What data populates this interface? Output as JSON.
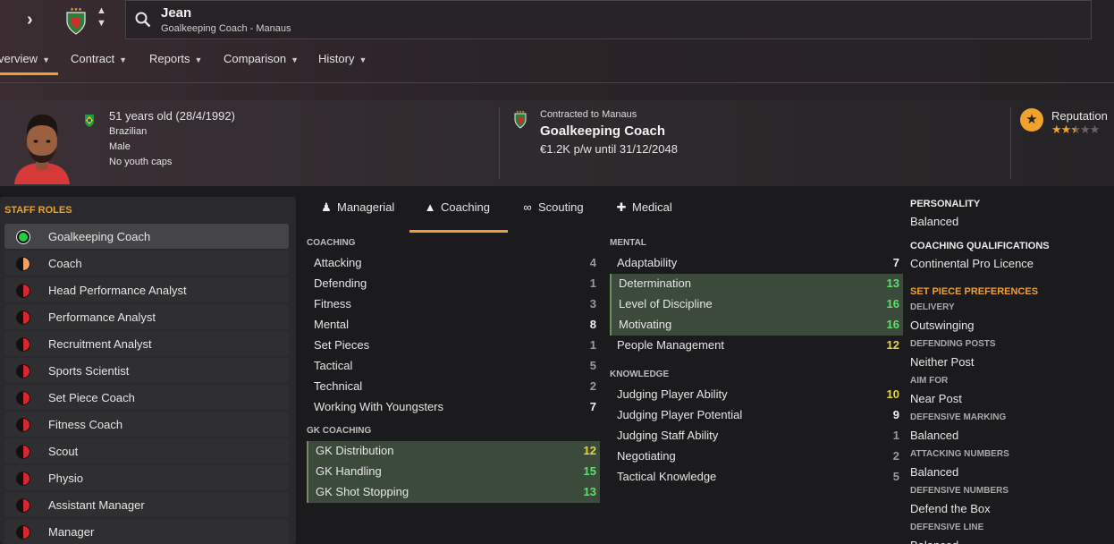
{
  "header": {
    "name": "Jean",
    "subtitle": "Goalkeeping Coach - Manaus",
    "icons": {
      "nav": "chevron-right-icon",
      "crest": "club-crest-icon",
      "search": "search-icon"
    }
  },
  "tabs": [
    {
      "label": "Overview",
      "active": true
    },
    {
      "label": "Contract"
    },
    {
      "label": "Reports"
    },
    {
      "label": "Comparison"
    },
    {
      "label": "History"
    }
  ],
  "visible_tab_prefix": "verview",
  "profile": {
    "age": "51 years old (28/4/1992)",
    "nationality": "Brazilian",
    "gender": "Male",
    "youth_caps": "No youth caps"
  },
  "contract": {
    "label": "Contracted to Manaus",
    "role": "Goalkeeping Coach",
    "wage": "€1.2K p/w until 31/12/2048"
  },
  "reputation": {
    "label": "Reputation",
    "stars": 2.5,
    "max": 5
  },
  "staff_roles": {
    "title": "STAFF ROLES",
    "items": [
      {
        "label": "Goalkeeping Coach",
        "color": "#22cc44",
        "fill": "full",
        "selected": true
      },
      {
        "label": "Coach",
        "color": "#f0a064",
        "fill": "half"
      },
      {
        "label": "Head Performance Analyst",
        "color": "#d4262c",
        "fill": "half"
      },
      {
        "label": "Performance Analyst",
        "color": "#d4262c",
        "fill": "half"
      },
      {
        "label": "Recruitment Analyst",
        "color": "#d4262c",
        "fill": "half"
      },
      {
        "label": "Sports Scientist",
        "color": "#d4262c",
        "fill": "half"
      },
      {
        "label": "Set Piece Coach",
        "color": "#d4262c",
        "fill": "half"
      },
      {
        "label": "Fitness Coach",
        "color": "#d4262c",
        "fill": "half"
      },
      {
        "label": "Scout",
        "color": "#d4262c",
        "fill": "half"
      },
      {
        "label": "Physio",
        "color": "#d4262c",
        "fill": "half"
      },
      {
        "label": "Assistant Manager",
        "color": "#d4262c",
        "fill": "half"
      },
      {
        "label": "Manager",
        "color": "#d4262c",
        "fill": "half"
      }
    ]
  },
  "subtabs": [
    {
      "label": "Managerial",
      "icon": "managerial-icon"
    },
    {
      "label": "Coaching",
      "icon": "coaching-icon",
      "active": true
    },
    {
      "label": "Scouting",
      "icon": "binoculars-icon"
    },
    {
      "label": "Medical",
      "icon": "medical-kit-icon"
    }
  ],
  "coaching": {
    "title": "COACHING",
    "attrs": [
      {
        "name": "Attacking",
        "value": "4"
      },
      {
        "name": "Defending",
        "value": "1"
      },
      {
        "name": "Fitness",
        "value": "3"
      },
      {
        "name": "Mental",
        "value": "8"
      },
      {
        "name": "Set Pieces",
        "value": "1"
      },
      {
        "name": "Tactical",
        "value": "5"
      },
      {
        "name": "Technical",
        "value": "2"
      },
      {
        "name": "Working With Youngsters",
        "value": "7"
      }
    ]
  },
  "gk_coaching": {
    "title": "GK COACHING",
    "attrs": [
      {
        "name": "GK Distribution",
        "value": "12",
        "highlight": true
      },
      {
        "name": "GK Handling",
        "value": "15",
        "highlight": true
      },
      {
        "name": "GK Shot Stopping",
        "value": "13",
        "highlight": true
      }
    ]
  },
  "mental": {
    "title": "MENTAL",
    "attrs": [
      {
        "name": "Adaptability",
        "value": "7"
      },
      {
        "name": "Determination",
        "value": "13",
        "highlight": true
      },
      {
        "name": "Level of Discipline",
        "value": "16",
        "highlight": true
      },
      {
        "name": "Motivating",
        "value": "16",
        "highlight": true
      },
      {
        "name": "People Management",
        "value": "12"
      }
    ]
  },
  "knowledge": {
    "title": "KNOWLEDGE",
    "attrs": [
      {
        "name": "Judging Player Ability",
        "value": "10"
      },
      {
        "name": "Judging Player Potential",
        "value": "9"
      },
      {
        "name": "Judging Staff Ability",
        "value": "1"
      },
      {
        "name": "Negotiating",
        "value": "2"
      },
      {
        "name": "Tactical Knowledge",
        "value": "5"
      }
    ]
  },
  "value_colors": {
    "low": "#9a9a9a",
    "mid": "#f0f0f0",
    "good": "#e8d53a",
    "great": "#5ee06a"
  },
  "right_panel": {
    "personality_title": "PERSONALITY",
    "personality": "Balanced",
    "qualifications_title": "COACHING QUALIFICATIONS",
    "qualification": "Continental Pro Licence",
    "set_piece_title": "SET PIECE PREFERENCES",
    "prefs": [
      {
        "label": "DELIVERY",
        "value": "Outswinging"
      },
      {
        "label": "DEFENDING POSTS",
        "value": "Neither Post"
      },
      {
        "label": "AIM FOR",
        "value": "Near Post"
      },
      {
        "label": "DEFENSIVE MARKING",
        "value": "Balanced"
      },
      {
        "label": "ATTACKING NUMBERS",
        "value": "Balanced"
      },
      {
        "label": "DEFENSIVE NUMBERS",
        "value": "Defend the Box"
      },
      {
        "label": "DEFENSIVE LINE",
        "value": "Balanced"
      }
    ]
  }
}
